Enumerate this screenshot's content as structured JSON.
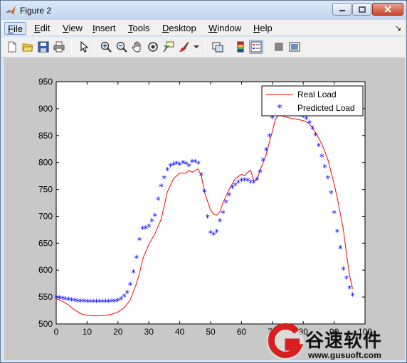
{
  "window": {
    "title": "Figure 2",
    "minimize_icon": "minimize-icon",
    "maximize_icon": "maximize-icon",
    "close_icon": "close-icon"
  },
  "menubar": {
    "items": [
      {
        "label": "File",
        "mnemonic": "F",
        "rest": "ile"
      },
      {
        "label": "Edit",
        "mnemonic": "E",
        "rest": "dit"
      },
      {
        "label": "View",
        "mnemonic": "V",
        "rest": "iew"
      },
      {
        "label": "Insert",
        "mnemonic": "I",
        "rest": "nsert"
      },
      {
        "label": "Tools",
        "mnemonic": "T",
        "rest": "ools"
      },
      {
        "label": "Desktop",
        "mnemonic": "D",
        "rest": "esktop"
      },
      {
        "label": "Window",
        "mnemonic": "W",
        "rest": "indow"
      },
      {
        "label": "Help",
        "mnemonic": "H",
        "rest": "elp"
      }
    ],
    "dock_icon": "dock-arrow-icon"
  },
  "toolbar": {
    "buttons": [
      "new-figure-icon",
      "open-file-icon",
      "save-icon",
      "print-icon",
      "edit-plot-icon",
      "zoom-in-icon",
      "zoom-out-icon",
      "pan-icon",
      "rotate-3d-icon",
      "data-cursor-icon",
      "brush-icon",
      "brush-dropdown-icon",
      "link-plot-icon",
      "insert-colorbar-icon",
      "insert-legend-icon",
      "hide-plot-tools-icon",
      "show-plot-tools-icon"
    ]
  },
  "colors": {
    "real_load": "#ff0000",
    "predicted_load": "#0000ff",
    "figure_bg": "#c8c8c8",
    "axes_bg": "#ffffff"
  },
  "chart_data": {
    "type": "line",
    "title": "",
    "xlabel": "",
    "ylabel": "",
    "xlim": [
      0,
      100
    ],
    "ylim": [
      500,
      950
    ],
    "xticks": [
      0,
      10,
      20,
      30,
      40,
      50,
      60,
      70,
      80,
      90,
      100
    ],
    "yticks": [
      500,
      550,
      600,
      650,
      700,
      750,
      800,
      850,
      900,
      950
    ],
    "grid": false,
    "legend_position": "top-right",
    "series": [
      {
        "name": "Real Load",
        "style": "line",
        "color": "#ff0000",
        "x": [
          0,
          2,
          4,
          6,
          8,
          10,
          12,
          14,
          16,
          18,
          20,
          22,
          24,
          25,
          26,
          27,
          28,
          30,
          32,
          34,
          35,
          36,
          38,
          40,
          42,
          43,
          44,
          46,
          47,
          48,
          49,
          50,
          51,
          52,
          53,
          54,
          56,
          58,
          60,
          61,
          62,
          63,
          64,
          65,
          66,
          67,
          68,
          70,
          71,
          72,
          74,
          76,
          78,
          80,
          82,
          84,
          86,
          88,
          90,
          91,
          92,
          93,
          94,
          95,
          96
        ],
        "y": [
          547,
          542,
          535,
          526,
          519,
          516,
          515,
          515,
          516,
          518,
          522,
          530,
          545,
          560,
          575,
          595,
          620,
          648,
          668,
          695,
          720,
          745,
          770,
          780,
          780,
          785,
          782,
          788,
          775,
          745,
          728,
          712,
          704,
          702,
          708,
          725,
          750,
          770,
          778,
          775,
          782,
          785,
          765,
          768,
          785,
          800,
          815,
          858,
          880,
          888,
          885,
          882,
          880,
          878,
          872,
          855,
          835,
          805,
          760,
          735,
          705,
          675,
          630,
          590,
          565
        ]
      },
      {
        "name": "Predicted Load",
        "style": "marker-star",
        "color": "#0000ff",
        "x": [
          0,
          1,
          2,
          3,
          4,
          5,
          6,
          7,
          8,
          9,
          10,
          11,
          12,
          13,
          14,
          15,
          16,
          17,
          18,
          19,
          20,
          21,
          22,
          23,
          24,
          25,
          26,
          27,
          28,
          29,
          30,
          31,
          32,
          33,
          34,
          35,
          36,
          37,
          38,
          39,
          40,
          41,
          42,
          43,
          44,
          45,
          46,
          47,
          48,
          49,
          50,
          51,
          52,
          53,
          54,
          55,
          56,
          57,
          58,
          59,
          60,
          61,
          62,
          63,
          64,
          65,
          66,
          67,
          68,
          69,
          70,
          71,
          72,
          73,
          74,
          75,
          76,
          77,
          78,
          79,
          80,
          81,
          82,
          83,
          84,
          85,
          86,
          87,
          88,
          89,
          90,
          91,
          92,
          93,
          94,
          95,
          96
        ],
        "y": [
          548,
          547,
          546,
          545,
          544,
          543,
          542,
          541,
          541,
          541,
          540,
          540,
          540,
          540,
          540,
          540,
          540,
          540,
          541,
          541,
          542,
          545,
          550,
          557,
          572,
          595,
          622,
          655,
          676,
          677,
          680,
          690,
          700,
          730,
          755,
          770,
          785,
          792,
          795,
          797,
          795,
          798,
          796,
          792,
          800,
          800,
          797,
          775,
          745,
          697,
          668,
          665,
          670,
          690,
          705,
          725,
          738,
          752,
          757,
          762,
          765,
          766,
          765,
          762,
          762,
          767,
          782,
          803,
          822,
          848,
          882,
          895,
          893,
          895,
          893,
          892,
          891,
          890,
          888,
          886,
          884,
          880,
          873,
          862,
          850,
          830,
          810,
          790,
          770,
          742,
          705,
          670,
          640,
          600,
          584,
          565,
          552
        ]
      }
    ]
  },
  "watermark": {
    "name_cn": "谷速软件",
    "url": "www.gusuoft.com"
  }
}
